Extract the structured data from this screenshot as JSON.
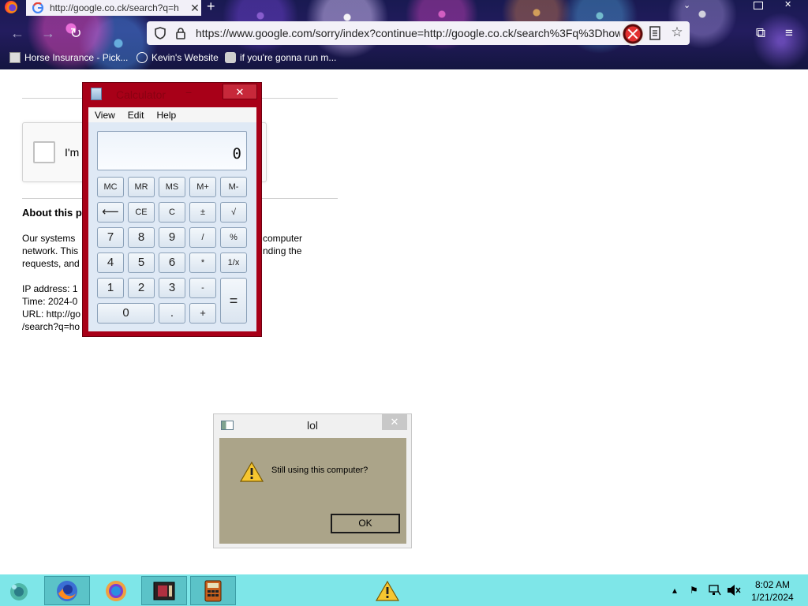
{
  "browser": {
    "tab_title": "http://google.co.ck/search?q=h",
    "tab_close": "✕",
    "new_tab": "+",
    "url": "https://www.google.com/sorry/index?continue=http://google.co.ck/search%3Fq%3Dhow",
    "bookmarks": [
      "Horse Insurance - Pick...",
      "Kevin's Website",
      "if you're gonna run m..."
    ]
  },
  "page": {
    "recaptcha_label": "I'm",
    "about_heading": "About this p",
    "para_lines": [
      "Our systems",
      "network. This",
      "requests, and"
    ],
    "para_right_lines": [
      "computer",
      "nding the"
    ],
    "ip_line": "IP address: 1",
    "time_line": "Time: 2024-0",
    "url_line": "URL: http://go",
    "search_line": "/search?q=ho"
  },
  "calculator": {
    "title": "Calculator",
    "minimize": "−",
    "close": "✕",
    "menu": [
      "View",
      "Edit",
      "Help"
    ],
    "display": "0",
    "memory_row": [
      "MC",
      "MR",
      "MS",
      "M+",
      "M-"
    ],
    "row2": [
      "⟵",
      "CE",
      "C",
      "±",
      "√"
    ],
    "row3": [
      "7",
      "8",
      "9",
      "/",
      "%"
    ],
    "row4": [
      "4",
      "5",
      "6",
      "*",
      "1/x"
    ],
    "row5": [
      "1",
      "2",
      "3",
      "-"
    ],
    "row6": [
      "0",
      ".",
      "+"
    ],
    "equals": "="
  },
  "dialog": {
    "title": "lol",
    "close": "✕",
    "message": "Still using this computer?",
    "ok_label": "OK"
  },
  "taskbar": {
    "time": "8:02 AM",
    "date": "1/21/2024"
  }
}
